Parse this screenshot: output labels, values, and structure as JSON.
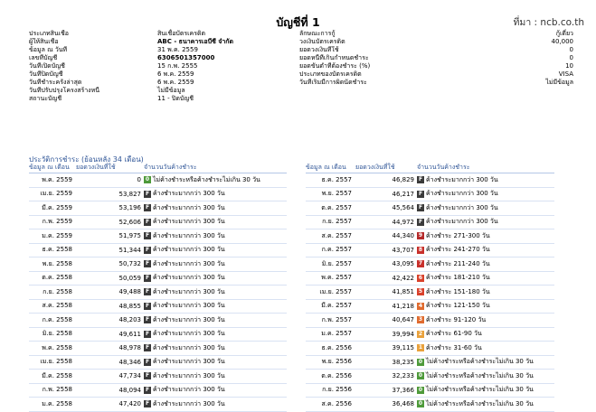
{
  "header": {
    "title": "บัญชีที่ 1",
    "source": "ที่มา : ncb.co.th"
  },
  "info_left": [
    {
      "label": "ประเภทสินเชื่อ",
      "value": "สินเชื่อบัตรเครดิต",
      "bold": false
    },
    {
      "label": "ผู้ให้สินเชื่อ",
      "value": "ABC - ธนาคารเอบีซี จำกัด",
      "bold": true
    },
    {
      "label": "ข้อมูล ณ วันที่",
      "value": "31 พ.ค. 2559",
      "bold": false
    },
    {
      "label": "เลขที่บัญชี",
      "value": "6306501357000",
      "bold": true
    },
    {
      "label": "วันที่เปิดบัญชี",
      "value": "15 ก.พ. 2555",
      "bold": false
    },
    {
      "label": "วันที่ปิดบัญชี",
      "value": "6 พ.ค. 2559",
      "bold": false
    },
    {
      "label": "วันที่ชำระครั้งล่าสุด",
      "value": "6 พ.ค. 2559",
      "bold": false
    },
    {
      "label": "วันที่ปรับปรุงโครงสร้างหนี้",
      "value": "ไม่มีข้อมูล",
      "bold": false
    },
    {
      "label": "สถานะบัญชี",
      "value": "11 - ปิดบัญชี",
      "bold": false
    }
  ],
  "info_right": [
    {
      "label": "ลักษณะการกู้",
      "value": "กู้เดี่ยว"
    },
    {
      "label": "วงเงินบัตรเครดิต",
      "value": "40,000"
    },
    {
      "label": "ยอดวงเงินที่ใช้",
      "value": "0"
    },
    {
      "label": "ยอดหนี้ที่เกินกำหนดชำระ",
      "value": "0"
    },
    {
      "label": "ยอดขั้นต่ำที่ต้องชำระ (%)",
      "value": "10"
    },
    {
      "label": "ประเภทของบัตรเครดิต",
      "value": "VISA"
    },
    {
      "label": "วันที่เริ่มมีการผิดนัดชำระ",
      "value": "ไม่มีข้อมูล"
    }
  ],
  "history": {
    "title": "ประวัติการชำระ (ย้อนหลัง 34 เดือน)",
    "columns": [
      "ข้อมูล ณ เดือน",
      "ยอดวงเงินที่ใช้",
      "จำนวนวันค้างชำระ"
    ],
    "left": [
      {
        "date": "พ.ค. 2559",
        "amount": "0",
        "code": "0",
        "status": "ไม่ค้างชำระหรือค้างชำระไม่เกิน 30 วัน"
      },
      {
        "date": "เม.ย. 2559",
        "amount": "53,827",
        "code": "F",
        "status": "ค้างชำระมากกว่า 300 วัน"
      },
      {
        "date": "มี.ค. 2559",
        "amount": "53,196",
        "code": "F",
        "status": "ค้างชำระมากกว่า 300 วัน"
      },
      {
        "date": "ก.พ. 2559",
        "amount": "52,606",
        "code": "F",
        "status": "ค้างชำระมากกว่า 300 วัน"
      },
      {
        "date": "ม.ค. 2559",
        "amount": "51,975",
        "code": "F",
        "status": "ค้างชำระมากกว่า 300 วัน"
      },
      {
        "date": "ธ.ค. 2558",
        "amount": "51,344",
        "code": "F",
        "status": "ค้างชำระมากกว่า 300 วัน"
      },
      {
        "date": "พ.ย. 2558",
        "amount": "50,732",
        "code": "F",
        "status": "ค้างชำระมากกว่า 300 วัน"
      },
      {
        "date": "ต.ค. 2558",
        "amount": "50,059",
        "code": "F",
        "status": "ค้างชำระมากกว่า 300 วัน"
      },
      {
        "date": "ก.ย. 2558",
        "amount": "49,488",
        "code": "F",
        "status": "ค้างชำระมากกว่า 300 วัน"
      },
      {
        "date": "ส.ค. 2558",
        "amount": "48,855",
        "code": "F",
        "status": "ค้างชำระมากกว่า 300 วัน"
      },
      {
        "date": "ก.ค. 2558",
        "amount": "48,203",
        "code": "F",
        "status": "ค้างชำระมากกว่า 300 วัน"
      },
      {
        "date": "มิ.ย. 2558",
        "amount": "49,611",
        "code": "F",
        "status": "ค้างชำระมากกว่า 300 วัน"
      },
      {
        "date": "พ.ค. 2558",
        "amount": "48,978",
        "code": "F",
        "status": "ค้างชำระมากกว่า 300 วัน"
      },
      {
        "date": "เม.ย. 2558",
        "amount": "48,346",
        "code": "F",
        "status": "ค้างชำระมากกว่า 300 วัน"
      },
      {
        "date": "มี.ค. 2558",
        "amount": "47,734",
        "code": "F",
        "status": "ค้างชำระมากกว่า 300 วัน"
      },
      {
        "date": "ก.พ. 2558",
        "amount": "48,094",
        "code": "F",
        "status": "ค้างชำระมากกว่า 300 วัน"
      },
      {
        "date": "ม.ค. 2558",
        "amount": "47,420",
        "code": "F",
        "status": "ค้างชำระมากกว่า 300 วัน"
      }
    ],
    "right": [
      {
        "date": "ธ.ค. 2557",
        "amount": "46,829",
        "code": "F",
        "status": "ค้างชำระมากกว่า 300 วัน"
      },
      {
        "date": "พ.ย. 2557",
        "amount": "46,217",
        "code": "F",
        "status": "ค้างชำระมากกว่า 300 วัน"
      },
      {
        "date": "ต.ค. 2557",
        "amount": "45,564",
        "code": "F",
        "status": "ค้างชำระมากกว่า 300 วัน"
      },
      {
        "date": "ก.ย. 2557",
        "amount": "44,972",
        "code": "F",
        "status": "ค้างชำระมากกว่า 300 วัน"
      },
      {
        "date": "ส.ค. 2557",
        "amount": "44,340",
        "code": "9",
        "status": "ค้างชำระ 271-300 วัน"
      },
      {
        "date": "ก.ค. 2557",
        "amount": "43,707",
        "code": "8",
        "status": "ค้างชำระ 241-270 วัน"
      },
      {
        "date": "มิ.ย. 2557",
        "amount": "43,095",
        "code": "7",
        "status": "ค้างชำระ 211-240 วัน"
      },
      {
        "date": "พ.ค. 2557",
        "amount": "42,422",
        "code": "6",
        "status": "ค้างชำระ 181-210 วัน"
      },
      {
        "date": "เม.ย. 2557",
        "amount": "41,851",
        "code": "5",
        "status": "ค้างชำระ 151-180 วัน"
      },
      {
        "date": "มี.ค. 2557",
        "amount": "41,218",
        "code": "4",
        "status": "ค้างชำระ 121-150 วัน"
      },
      {
        "date": "ก.พ. 2557",
        "amount": "40,647",
        "code": "3",
        "status": "ค้างชำระ 91-120 วัน"
      },
      {
        "date": "ม.ค. 2557",
        "amount": "39,994",
        "code": "2",
        "status": "ค้างชำระ 61-90 วัน"
      },
      {
        "date": "ธ.ค. 2556",
        "amount": "39,115",
        "code": "1",
        "status": "ค้างชำระ 31-60 วัน"
      },
      {
        "date": "พ.ย. 2556",
        "amount": "38,235",
        "code": "0",
        "status": "ไม่ค้างชำระหรือค้างชำระไม่เกิน 30 วัน"
      },
      {
        "date": "ต.ค. 2556",
        "amount": "32,233",
        "code": "0",
        "status": "ไม่ค้างชำระหรือค้างชำระไม่เกิน 30 วัน"
      },
      {
        "date": "ก.ย. 2556",
        "amount": "37,366",
        "code": "0",
        "status": "ไม่ค้างชำระหรือค้างชำระไม่เกิน 30 วัน"
      },
      {
        "date": "ส.ค. 2556",
        "amount": "36,468",
        "code": "0",
        "status": "ไม่ค้างชำระหรือค้างชำระไม่เกิน 30 วัน"
      }
    ]
  },
  "code_colors": {
    "0": "#4e9a3a",
    "1": "#e9a13b",
    "2": "#e9a13b",
    "3": "#e06b2f",
    "4": "#e06b2f",
    "5": "#d9412b",
    "6": "#d9412b",
    "7": "#c8302b",
    "8": "#c8302b",
    "9": "#b52a2a",
    "F": "#3a3a3a"
  }
}
